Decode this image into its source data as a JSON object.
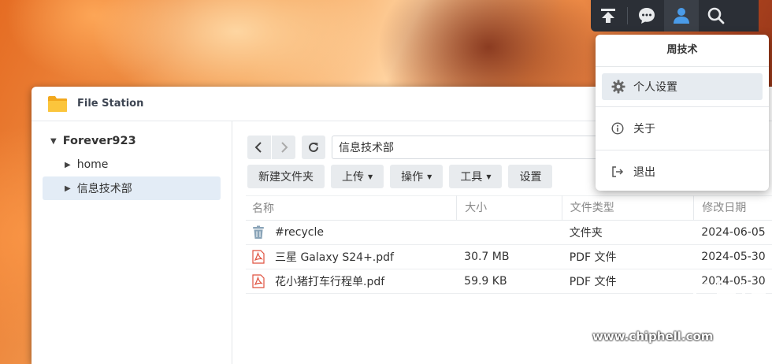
{
  "topbar": {
    "icons": [
      "upload-icon",
      "message-icon",
      "user-icon",
      "search-icon"
    ],
    "accent": "#4a9be8"
  },
  "user_menu": {
    "username": "周技术",
    "items": [
      {
        "label": "个人设置",
        "icon": "gear-icon"
      },
      {
        "label": "关于",
        "icon": "info-icon"
      },
      {
        "label": "退出",
        "icon": "logout-icon"
      }
    ]
  },
  "window": {
    "title": "File Station",
    "sidebar": {
      "root": "Forever923",
      "items": [
        {
          "label": "home"
        },
        {
          "label": "信息技术部"
        }
      ]
    },
    "path": "信息技术部",
    "toolbar": {
      "new_folder": "新建文件夹",
      "upload": "上传",
      "action": "操作",
      "tools": "工具",
      "settings": "设置"
    },
    "columns": {
      "name": "名称",
      "size": "大小",
      "type": "文件类型",
      "modified": "修改日期"
    },
    "files": [
      {
        "name": "#recycle",
        "size": "",
        "type": "文件夹",
        "modified": "2024-06-05",
        "icon": "recycle-bin-icon"
      },
      {
        "name": "三星 Galaxy S24+.pdf",
        "size": "30.7 MB",
        "type": "PDF 文件",
        "modified": "2024-05-30",
        "icon": "pdf-icon"
      },
      {
        "name": "花小猪打车行程单.pdf",
        "size": "59.9 KB",
        "type": "PDF 文件",
        "modified": "2024-05-30",
        "icon": "pdf-icon"
      }
    ]
  },
  "watermark": {
    "url": "www.chiphell.com"
  }
}
